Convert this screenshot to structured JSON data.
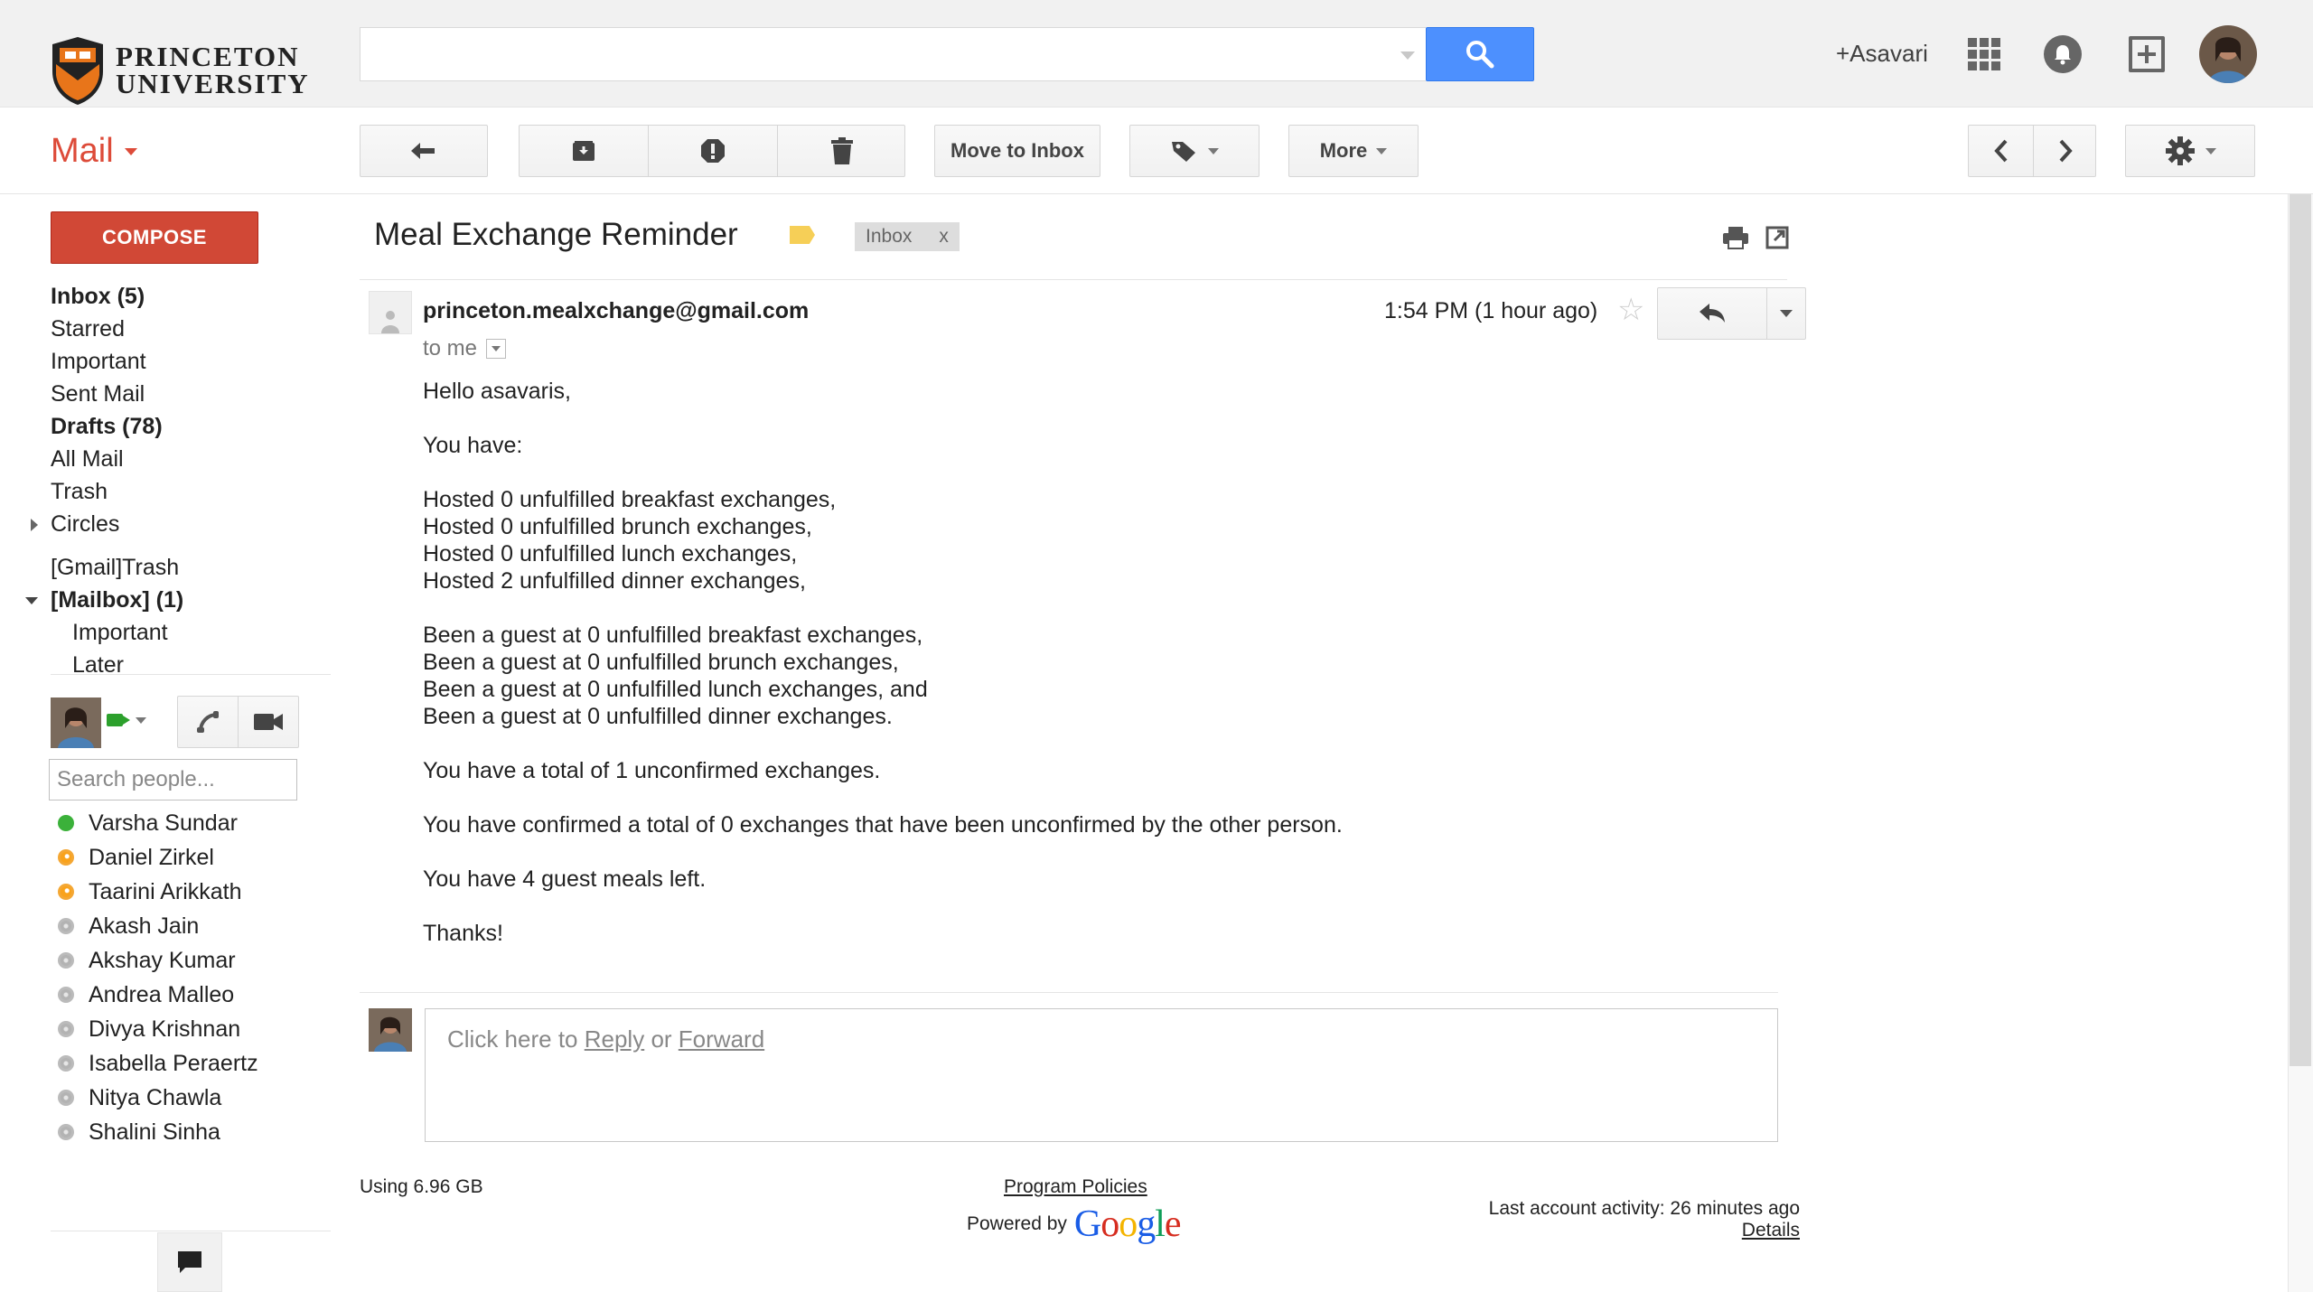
{
  "header": {
    "logo_line1": "PRINCETON",
    "logo_line2": "UNIVERSITY",
    "search_value": "",
    "account_name": "+Asavari",
    "icons": [
      "search-icon",
      "apps-icon",
      "notifications-icon",
      "share-icon"
    ]
  },
  "toolbar": {
    "mail_label": "Mail",
    "move_to_inbox": "Move to Inbox",
    "more": "More",
    "icons": [
      "back-arrow-icon",
      "archive-icon",
      "spam-icon",
      "trash-icon",
      "label-icon",
      "chevron-left-icon",
      "chevron-right-icon",
      "gear-icon"
    ]
  },
  "sidebar": {
    "compose": "COMPOSE",
    "items": [
      {
        "label": "Inbox (5)",
        "bold": true
      },
      {
        "label": "Starred",
        "bold": false
      },
      {
        "label": "Important",
        "bold": false
      },
      {
        "label": "Sent Mail",
        "bold": false
      },
      {
        "label": "Drafts (78)",
        "bold": true
      },
      {
        "label": "All Mail",
        "bold": false
      },
      {
        "label": "Trash",
        "bold": false
      },
      {
        "label": "Circles",
        "bold": false
      },
      {
        "label": "[Gmail]Trash",
        "bold": false
      },
      {
        "label": "[Mailbox] (1)",
        "bold": true
      },
      {
        "label": "Important",
        "bold": false
      },
      {
        "label": "Later",
        "bold": false
      }
    ]
  },
  "chat": {
    "search_placeholder": "Search people...",
    "contacts": [
      {
        "name": "Varsha Sundar",
        "status": "available"
      },
      {
        "name": "Daniel Zirkel",
        "status": "idle"
      },
      {
        "name": "Taarini Arikkath",
        "status": "idle"
      },
      {
        "name": "Akash Jain",
        "status": "offline"
      },
      {
        "name": "Akshay Kumar",
        "status": "offline"
      },
      {
        "name": "Andrea Malleo",
        "status": "offline"
      },
      {
        "name": "Divya Krishnan",
        "status": "offline"
      },
      {
        "name": "Isabella Peraertz",
        "status": "offline"
      },
      {
        "name": "Nitya Chawla",
        "status": "offline"
      },
      {
        "name": "Shalini Sinha",
        "status": "offline"
      }
    ]
  },
  "message": {
    "subject": "Meal Exchange Reminder",
    "label_chip": "Inbox",
    "label_chip_close": "x",
    "sender": "princeton.mealxchange@gmail.com",
    "to": "to me",
    "time": "1:54 PM (1 hour ago)",
    "body": {
      "greeting": "Hello asavaris,",
      "intro": "You have:",
      "hosted": [
        "Hosted 0 unfulfilled breakfast exchanges,",
        "Hosted 0 unfulfilled brunch exchanges,",
        "Hosted 0 unfulfilled lunch exchanges,",
        "Hosted 2 unfulfilled dinner exchanges,"
      ],
      "guest": [
        "Been a guest at 0 unfulfilled breakfast exchanges,",
        "Been a guest at 0 unfulfilled brunch exchanges,",
        "Been a guest at 0 unfulfilled lunch exchanges, and",
        "Been a guest at 0 unfulfilled dinner exchanges."
      ],
      "total_unconfirmed": "You have a total of 1 unconfirmed exchanges.",
      "confirmed": "You have confirmed a total of 0 exchanges that have been unconfirmed by the other person.",
      "guest_meals": "You have 4 guest meals left.",
      "signoff": "Thanks!"
    }
  },
  "reply": {
    "prefix": "Click here to ",
    "reply_link": "Reply",
    "or": " or ",
    "forward_link": "Forward"
  },
  "footer": {
    "usage": "Using 6.96 GB",
    "policies": "Program Policies",
    "powered_by": "Powered by",
    "google": [
      "G",
      "o",
      "o",
      "g",
      "l",
      "e"
    ],
    "google_colors": [
      "#1a5de6",
      "#d62d20",
      "#f4b400",
      "#1a5de6",
      "#0f9d58",
      "#d62d20"
    ],
    "last_activity": "Last account activity: 26 minutes ago",
    "details": "Details"
  },
  "colors": {
    "accent_red": "#dd4b39",
    "compose_red": "#d14836",
    "search_blue": "#4d90fe"
  }
}
